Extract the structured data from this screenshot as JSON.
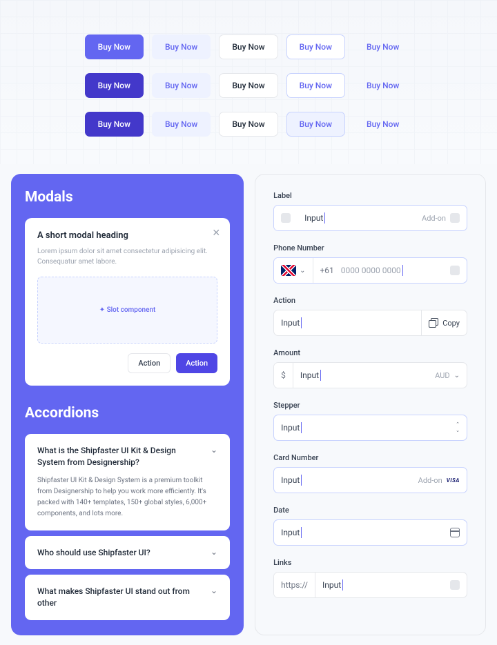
{
  "button_label": "Buy Now",
  "modals": {
    "title": "Modals",
    "heading": "A short modal heading",
    "description": "Lorem ipsum dolor sit amet consectetur adipisicing elit. Consequatur amet labore.",
    "slot_label": "✦ Slot component",
    "action_secondary": "Action",
    "action_primary": "Action"
  },
  "accordions": {
    "title": "Accordions",
    "items": [
      {
        "question": "What is the Shipfaster UI Kit & Design System from Designership?",
        "answer": "Shipfaster UI Kit & Design System is a premium toolkit from Designership to help you work more efficiently. It's packed with 140+ templates, 150+ global styles, 6,000+ components, and lots more."
      },
      {
        "question": "Who should use Shipfaster UI?"
      },
      {
        "question": "What makes Shipfaster UI stand out from other"
      }
    ]
  },
  "forms": {
    "label": {
      "label": "Label",
      "value": "Input",
      "addon": "Add-on"
    },
    "phone": {
      "label": "Phone Number",
      "code": "+61",
      "placeholder": "0000 0000 0000"
    },
    "action": {
      "label": "Action",
      "value": "Input",
      "button": "Copy"
    },
    "amount": {
      "label": "Amount",
      "symbol": "$",
      "value": "Input",
      "currency": "AUD"
    },
    "stepper": {
      "label": "Stepper",
      "value": "Input"
    },
    "card": {
      "label": "Card Number",
      "value": "Input",
      "addon": "Add-on",
      "brand": "VISA"
    },
    "date": {
      "label": "Date",
      "value": "Input"
    },
    "links": {
      "label": "Links",
      "prefix": "https://",
      "value": "Input"
    }
  }
}
